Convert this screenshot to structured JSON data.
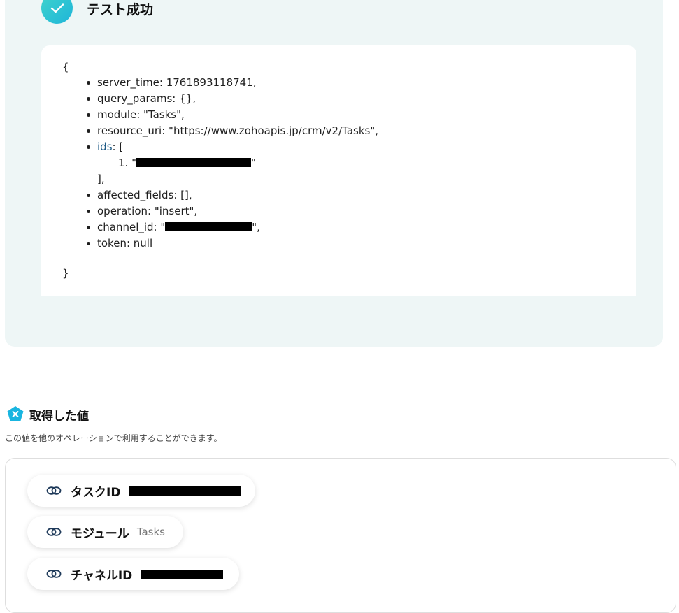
{
  "test_result": {
    "title": "テスト成功",
    "json_open": "{",
    "json_close": "}",
    "fields": [
      {
        "text": "server_time: 1761893118741,"
      },
      {
        "text": "query_params: {},"
      },
      {
        "text": "module: \"Tasks\","
      },
      {
        "text": "resource_uri: \"https://www.zohoapis.jp/crm/v2/Tasks\","
      }
    ],
    "ids_key": "ids",
    "ids_open": ": [",
    "ids_item_prefix": "1. \"",
    "ids_item_suffix": "\"",
    "ids_close": "],",
    "affected_fields": "affected_fields: [],",
    "operation": "operation: \"insert\",",
    "channel_prefix": "channel_id: \"",
    "channel_suffix": "\",",
    "token": "token: null"
  },
  "acquired": {
    "title": "取得した値",
    "description": "この値を他のオペレーションで利用することができます。",
    "items": [
      {
        "label": "タスクID",
        "value": "",
        "redacted": true
      },
      {
        "label": "モジュール",
        "value": "Tasks",
        "redacted": false
      },
      {
        "label": "チャネルID",
        "value": "",
        "redacted": true
      }
    ]
  },
  "colors": {
    "accent": "#1fb5d9",
    "panel": "#eef6f6",
    "link": "#1d5a86"
  }
}
